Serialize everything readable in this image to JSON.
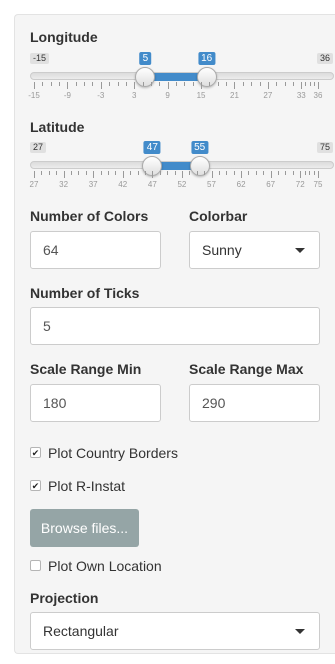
{
  "longitude": {
    "label": "Longitude",
    "min": -15,
    "max": 36,
    "from": 5,
    "to": 16,
    "min_label": "-15",
    "max_label": "36",
    "from_label": "5",
    "to_label": "16",
    "ticks": [
      "-15",
      "-9",
      "-3",
      "3",
      "9",
      "15",
      "21",
      "27",
      "33",
      "36"
    ]
  },
  "latitude": {
    "label": "Latitude",
    "min": 27,
    "max": 75,
    "from": 47,
    "to": 55,
    "min_label": "27",
    "max_label": "75",
    "from_label": "47",
    "to_label": "55",
    "ticks": [
      "27",
      "32",
      "37",
      "42",
      "47",
      "52",
      "57",
      "62",
      "67",
      "72",
      "75"
    ]
  },
  "num_colors": {
    "label": "Number of Colors",
    "value": "64"
  },
  "colorbar": {
    "label": "Colorbar",
    "value": "Sunny"
  },
  "num_ticks": {
    "label": "Number of Ticks",
    "value": "5"
  },
  "scale_min": {
    "label": "Scale Range Min",
    "value": "180"
  },
  "scale_max": {
    "label": "Scale Range Max",
    "value": "290"
  },
  "plot_borders": {
    "label": "Plot Country Borders",
    "checked": true
  },
  "plot_rinstat": {
    "label": "Plot R-Instat",
    "checked": true
  },
  "browse_button": {
    "label": "Browse files..."
  },
  "plot_own_location": {
    "label": "Plot Own Location",
    "checked": false
  },
  "projection": {
    "label": "Projection",
    "value": "Rectangular"
  },
  "colors": {
    "accent": "#428bca",
    "button": "#95a5a6",
    "panel": "#f5f5f5"
  },
  "check_glyph": "✔"
}
